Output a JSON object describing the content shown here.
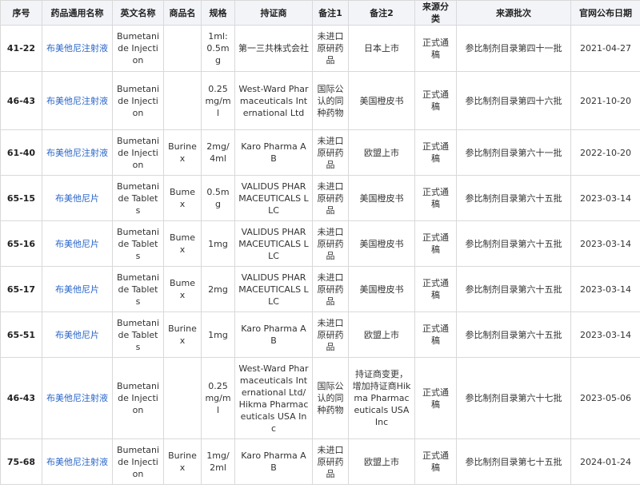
{
  "table": {
    "headers": [
      "序号",
      "药品通用名称",
      "英文名称",
      "商品名",
      "规格",
      "持证商",
      "备注1",
      "备注2",
      "来源分类",
      "来源批次",
      "官网公布日期"
    ],
    "rows": [
      [
        "41-22",
        "布美他尼注射液",
        "Bumetanide Injection",
        "",
        "1ml:0.5mg",
        "第一三共株式会社",
        "未进口原研药品",
        "日本上市",
        "正式通稿",
        "参比制剂目录第四十一批",
        "2021-04-27"
      ],
      [
        "46-43",
        "布美他尼注射液",
        "Bumetanide Injection",
        "",
        "0.25mg/ml",
        "West-Ward Pharmaceuticals International Ltd",
        "国际公认的同种药物",
        "美国橙皮书",
        "正式通稿",
        "参比制剂目录第四十六批",
        "2021-10-20"
      ],
      [
        "61-40",
        "布美他尼注射液",
        "Bumetanide Injection",
        "Burinex",
        "2mg/4ml",
        "Karo Pharma AB",
        "未进口原研药品",
        "欧盟上市",
        "正式通稿",
        "参比制剂目录第六十一批",
        "2022-10-20"
      ],
      [
        "65-15",
        "布美他尼片",
        "Bumetanide Tablets",
        "Bumex",
        "0.5mg",
        "VALIDUS PHARMACEUTICALS LLC",
        "未进口原研药品",
        "美国橙皮书",
        "正式通稿",
        "参比制剂目录第六十五批",
        "2023-03-14"
      ],
      [
        "65-16",
        "布美他尼片",
        "Bumetanide Tablets",
        "Bumex",
        "1mg",
        "VALIDUS PHARMACEUTICALS LLC",
        "未进口原研药品",
        "美国橙皮书",
        "正式通稿",
        "参比制剂目录第六十五批",
        "2023-03-14"
      ],
      [
        "65-17",
        "布美他尼片",
        "Bumetanide Tablets",
        "Bumex",
        "2mg",
        "VALIDUS PHARMACEUTICALS LLC",
        "未进口原研药品",
        "美国橙皮书",
        "正式通稿",
        "参比制剂目录第六十五批",
        "2023-03-14"
      ],
      [
        "65-51",
        "布美他尼片",
        "Bumetanide Tablets",
        "Burinex",
        "1mg",
        "Karo Pharma AB",
        "未进口原研药品",
        "欧盟上市",
        "正式通稿",
        "参比制剂目录第六十五批",
        "2023-03-14"
      ],
      [
        "46-43",
        "布美他尼注射液",
        "Bumetanide Injection",
        "",
        "0.25mg/ml",
        "West-Ward Pharmaceuticals International Ltd/Hikma Pharmaceuticals USA Inc",
        "国际公认的同种药物",
        "持证商变更，增加持证商Hikma Pharmaceuticals USA Inc",
        "正式通稿",
        "参比制剂目录第六十七批",
        "2023-05-06"
      ],
      [
        "75-68",
        "布美他尼注射液",
        "Bumetanide Injection",
        "Burinex",
        "1mg/2ml",
        "Karo Pharma AB",
        "未进口原研药品",
        "欧盟上市",
        "正式通稿",
        "参比制剂目录第七十五批",
        "2024-01-24"
      ]
    ]
  }
}
